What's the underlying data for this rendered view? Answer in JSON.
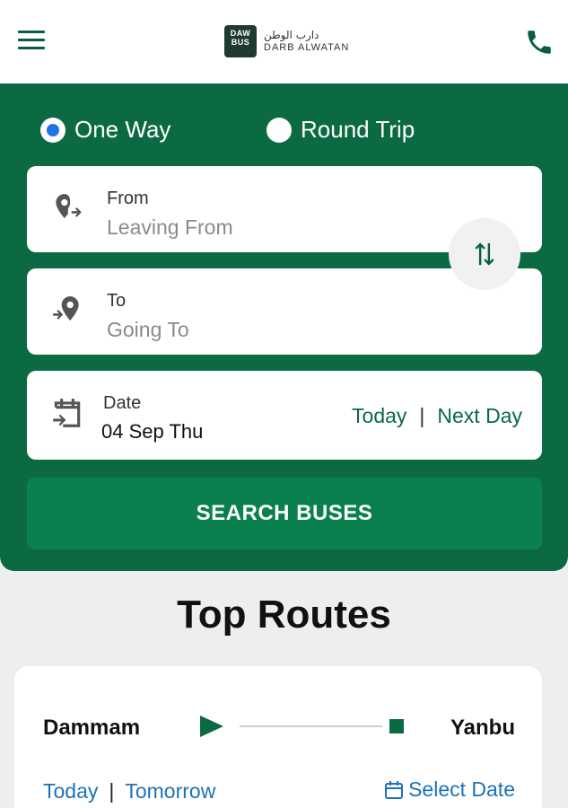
{
  "header": {
    "logo_line1": "DAW",
    "logo_line2": "BUS",
    "brand_arabic": "دارب الوطن",
    "brand_english": "DARB ALWATAN"
  },
  "trip_type": {
    "one_way": "One Way",
    "round_trip": "Round Trip",
    "selected": "One Way"
  },
  "from": {
    "label": "From",
    "placeholder": "Leaving From"
  },
  "to": {
    "label": "To",
    "placeholder": "Going To"
  },
  "date": {
    "label": "Date",
    "value": "04 Sep Thu",
    "today": "Today",
    "next_day": "Next Day",
    "separator": "|"
  },
  "search_button": "SEARCH BUSES",
  "top_routes": {
    "title": "Top Routes",
    "routes": [
      {
        "from": "Dammam",
        "to": "Yanbu",
        "today": "Today",
        "separator": "|",
        "tomorrow": "Tomorrow",
        "select_date": "Select Date"
      }
    ]
  },
  "colors": {
    "brand_green": "#0b6a42",
    "button_green": "#09804e",
    "radio_selected": "#1e74e8",
    "link_blue": "#1d72b8"
  }
}
